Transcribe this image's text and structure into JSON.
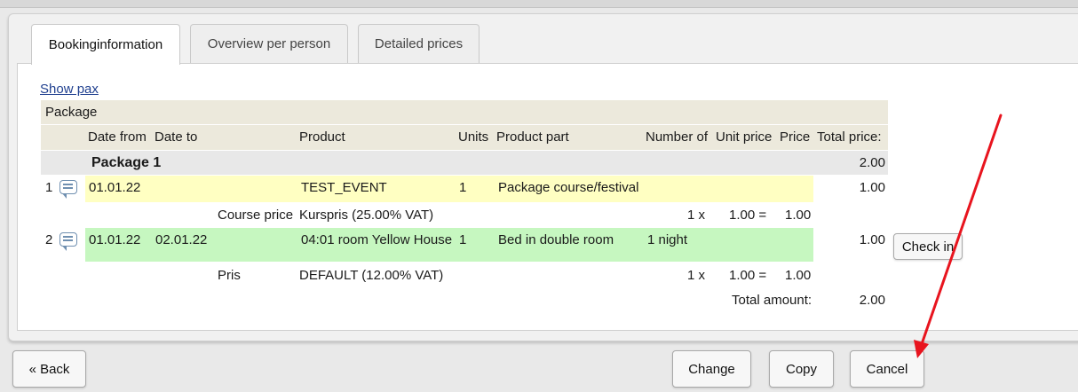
{
  "tabs": {
    "booking": "Bookinginformation",
    "overview": "Overview per person",
    "prices": "Detailed prices"
  },
  "show_pax": "Show pax",
  "table": {
    "section_label": "Package",
    "headers": {
      "date_from": "Date from",
      "date_to": "Date to",
      "product": "Product",
      "units": "Units",
      "product_part": "Product part",
      "number_of": "Number of",
      "unit_price": "Unit price",
      "price": "Price",
      "total_price": "Total price:"
    },
    "group": {
      "name": "Package 1",
      "total": "2.00"
    },
    "rows": [
      {
        "num": "1",
        "date_from": "01.01.22",
        "date_to": "",
        "product": "TEST_EVENT",
        "units": "1",
        "product_part": "Package course/festival",
        "number_of": "",
        "total": "1.00",
        "sub": {
          "label": "Course price",
          "product": "Kurspris (25.00% VAT)",
          "qty": "1 x",
          "unit_price": "1.00 =",
          "price": "1.00"
        }
      },
      {
        "num": "2",
        "date_from": "01.01.22",
        "date_to": "02.01.22",
        "product": "04:01 room Yellow House",
        "units": "1",
        "product_part": "Bed in double room",
        "number_of": "1 night",
        "total": "1.00",
        "checkin_label": "Check in",
        "sub": {
          "label": "Pris",
          "product": "DEFAULT (12.00% VAT)",
          "qty": "1 x",
          "unit_price": "1.00 =",
          "price": "1.00"
        }
      }
    ],
    "total_amount_label": "Total amount:",
    "total_amount": "2.00"
  },
  "footer": {
    "back": "« Back",
    "change": "Change",
    "copy": "Copy",
    "cancel": "Cancel"
  },
  "colors": {
    "header_bg": "#ece9dc",
    "row_yellow": "#ffffc2",
    "row_green": "#c6f7c0",
    "arrow": "#e8141e"
  }
}
